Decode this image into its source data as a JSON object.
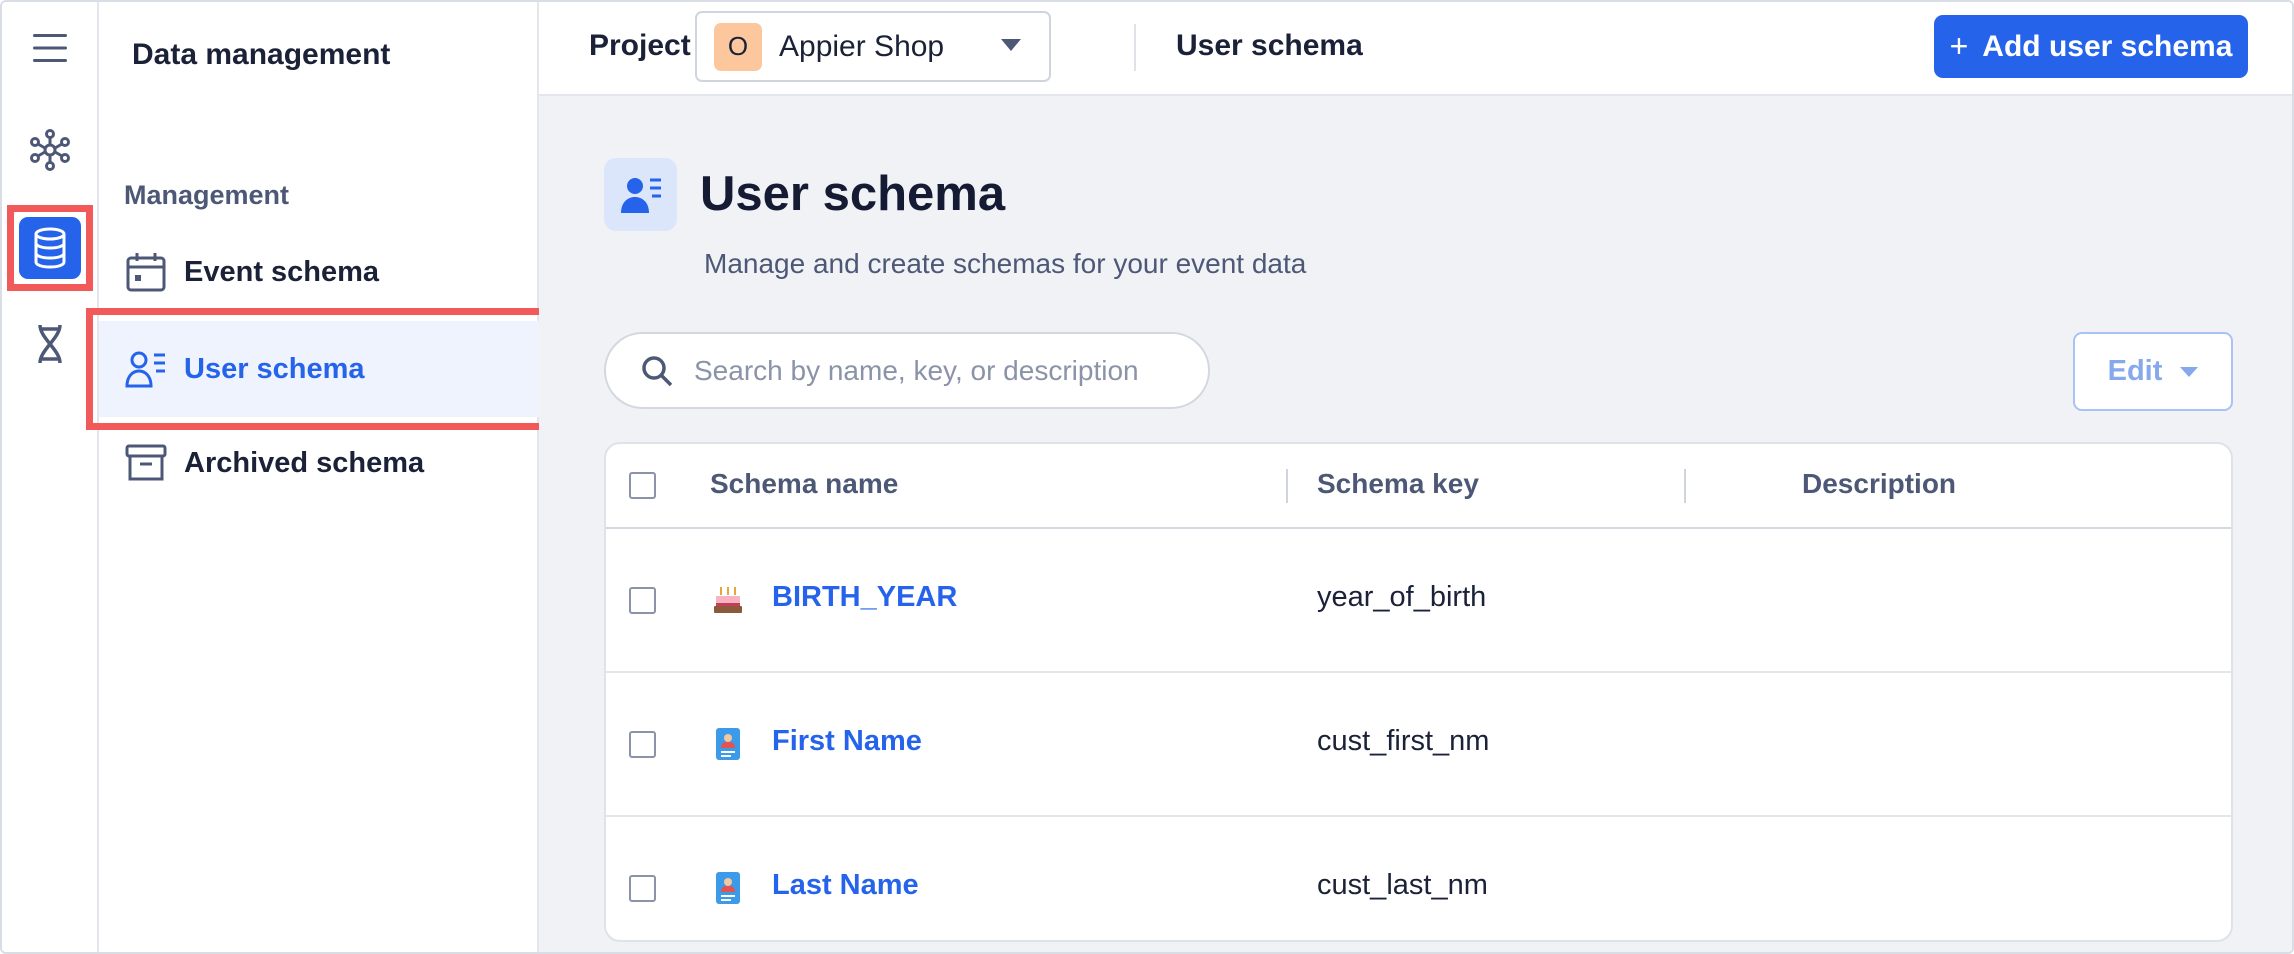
{
  "rail": {
    "items": [
      {
        "icon": "menu-icon"
      },
      {
        "icon": "network-icon"
      },
      {
        "icon": "database-icon",
        "active": true
      },
      {
        "icon": "dna-icon"
      }
    ]
  },
  "panel": {
    "title": "Data management",
    "section": "Management",
    "items": [
      {
        "label": "Event schema",
        "icon": "calendar-icon"
      },
      {
        "label": "User schema",
        "icon": "user-list-icon",
        "active": true
      },
      {
        "label": "Archived schema",
        "icon": "archive-icon"
      }
    ]
  },
  "header": {
    "project_label": "Project",
    "project_initial": "O",
    "project_name": "Appier Shop",
    "breadcrumb": "User schema",
    "add_button": "Add user schema",
    "add_icon": "+"
  },
  "main": {
    "title": "User schema",
    "subtitle": "Manage and create schemas for your event data",
    "search_placeholder": "Search by name, key, or description",
    "edit_label": "Edit"
  },
  "table": {
    "columns": [
      "Schema name",
      "Schema key",
      "Description"
    ],
    "rows": [
      {
        "name": "BIRTH_YEAR",
        "key": "year_of_birth",
        "description": "",
        "icon": "birthday-cake-icon"
      },
      {
        "name": "First Name",
        "key": "cust_first_nm",
        "description": "",
        "icon": "id-card-icon"
      },
      {
        "name": "Last Name",
        "key": "cust_last_nm",
        "description": "",
        "icon": "id-card-icon"
      }
    ]
  },
  "colors": {
    "accent": "#2563eb",
    "highlight": "#f25a5a",
    "avatar": "#fcc79d",
    "background": "#f0f2f6"
  }
}
